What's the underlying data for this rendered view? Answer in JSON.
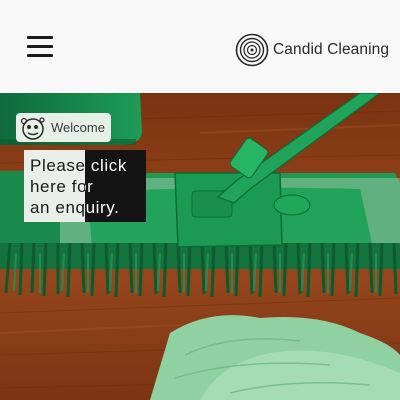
{
  "header": {
    "menu_icon": "hamburger-icon",
    "brand_name": "Candid Cleaning",
    "logo_icon": "spiral-logo-icon"
  },
  "welcome_badge": {
    "label": "Welcome",
    "icon": "cleaning-mascot-icon"
  },
  "cta": {
    "text": "Please click here for an enquiry."
  },
  "colors": {
    "header_bg": "#f8f8f8",
    "mop_green": "#1f9a55",
    "floor_wood": "#8a3a16",
    "cloth_green": "#8fd1a0",
    "cta_light": "#e8efe9",
    "cta_dark": "#141414"
  }
}
